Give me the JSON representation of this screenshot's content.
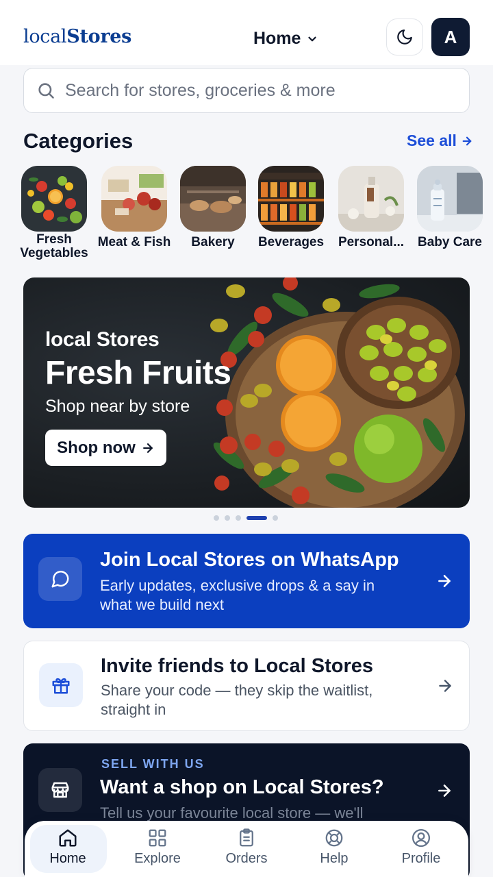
{
  "header": {
    "logo_light": "local",
    "logo_bold": "Stores",
    "location_label": "Home",
    "avatar_initial": "A"
  },
  "search": {
    "placeholder": "Search for stores, groceries & more"
  },
  "categories": {
    "title": "Categories",
    "see_all": "See all",
    "items": [
      {
        "label": "Fresh Vegetables"
      },
      {
        "label": "Meat & Fish"
      },
      {
        "label": "Bakery"
      },
      {
        "label": "Beverages"
      },
      {
        "label": "Personal..."
      },
      {
        "label": "Baby Care"
      }
    ]
  },
  "hero": {
    "brand": "local Stores",
    "title": "Fresh Fruits",
    "subtitle": "Shop near by store",
    "button": "Shop now",
    "carousel_total": 5,
    "carousel_active": 4
  },
  "promos": {
    "whatsapp": {
      "title": "Join Local Stores on WhatsApp",
      "desc": "Early updates, exclusive drops & a say in what we build next"
    },
    "invite": {
      "title": "Invite friends to Local Stores",
      "desc": "Share your code — they skip the waitlist, straight in"
    },
    "sell": {
      "eyebrow": "SELL WITH US",
      "title": "Want a shop on Local Stores?",
      "desc": "Tell us your favourite local store — we'll"
    }
  },
  "nav": {
    "items": [
      {
        "label": "Home",
        "icon": "home-icon"
      },
      {
        "label": "Explore",
        "icon": "grid-icon"
      },
      {
        "label": "Orders",
        "icon": "clipboard-icon"
      },
      {
        "label": "Help",
        "icon": "lifebuoy-icon"
      },
      {
        "label": "Profile",
        "icon": "user-icon"
      }
    ],
    "active": "Home"
  },
  "colors": {
    "brand": "#0b3d91",
    "accent": "#1d4ed8",
    "whatsapp_card": "#0b3fbf",
    "sell_card": "#0b1428"
  }
}
